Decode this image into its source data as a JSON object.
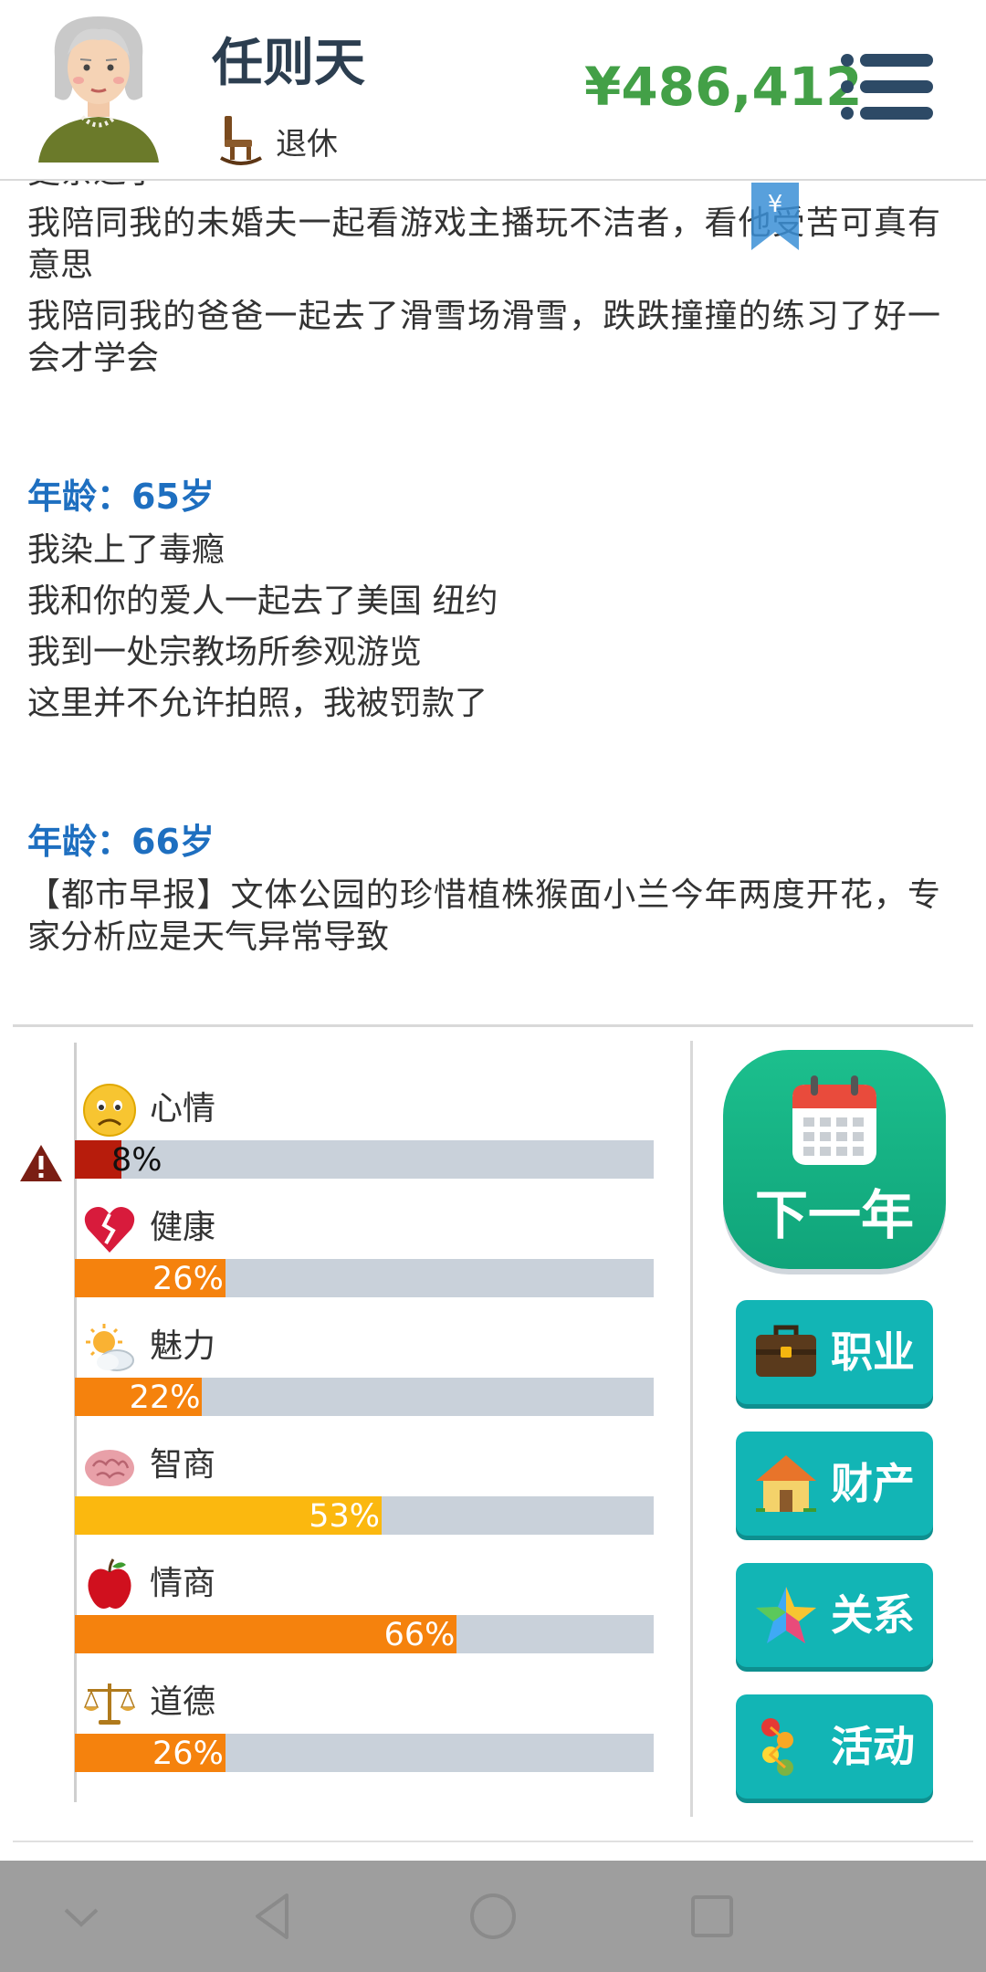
{
  "header": {
    "name": "任则天",
    "status": "退休",
    "money": "¥486,412"
  },
  "bookmark": {
    "symbol": "¥"
  },
  "log": {
    "intro_lines": [
      "更亲近了",
      "我陪同我的未婚夫一起看游戏主播玩不洁者，看他受苦可真有意思",
      "我陪同我的爸爸一起去了滑雪场滑雪，跌跌撞撞的练习了好一会才学会"
    ],
    "years": [
      {
        "age": "年龄：65岁",
        "events": [
          "我染上了毒瘾",
          "我和你的爱人一起去了美国 纽约",
          "我到一处宗教场所参观游览",
          "这里并不允许拍照，我被罚款了"
        ]
      },
      {
        "age": "年龄：66岁",
        "events": [
          "【都市早报】文体公园的珍惜植株猴面小兰今年两度开花，专家分析应是天气异常导致"
        ]
      }
    ]
  },
  "stats": [
    {
      "label": "心情",
      "icon": "sad-face-icon",
      "value": 8,
      "pct": "8%",
      "color": "#b71c0c"
    },
    {
      "label": "健康",
      "icon": "broken-heart-icon",
      "value": 26,
      "pct": "26%",
      "color": "#f5820d"
    },
    {
      "label": "魅力",
      "icon": "sun-cloud-icon",
      "value": 22,
      "pct": "22%",
      "color": "#f5820d"
    },
    {
      "label": "智商",
      "icon": "brain-icon",
      "value": 53,
      "pct": "53%",
      "color": "#fbb80f"
    },
    {
      "label": "情商",
      "icon": "apple-icon",
      "value": 66,
      "pct": "66%",
      "color": "#f5820d"
    },
    {
      "label": "道德",
      "icon": "scales-icon",
      "value": 26,
      "pct": "26%",
      "color": "#f5820d"
    }
  ],
  "buttons": {
    "next_year": "下一年",
    "career": "职业",
    "property": "财产",
    "relations": "关系",
    "activities": "活动"
  }
}
